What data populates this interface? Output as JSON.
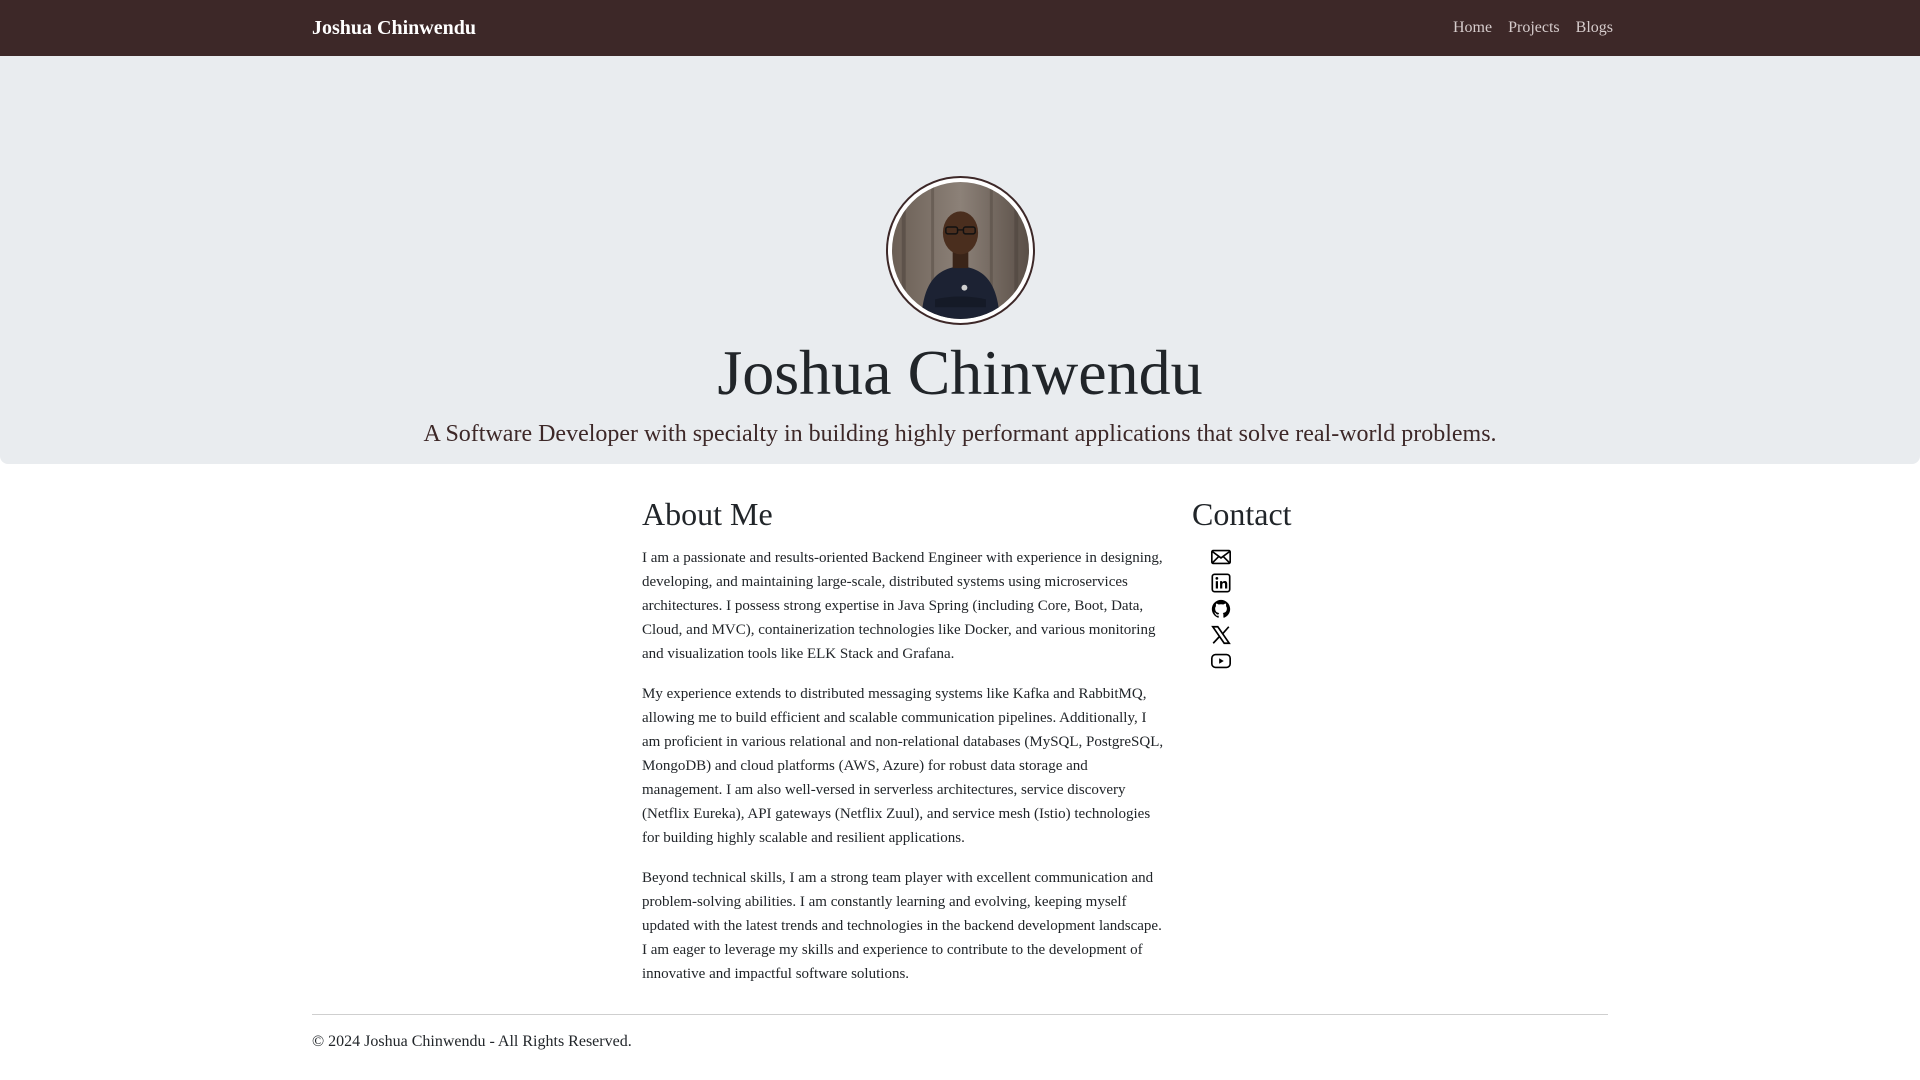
{
  "navbar": {
    "brand": "Joshua Chinwendu",
    "links": [
      "Home",
      "Projects",
      "Blogs"
    ]
  },
  "hero": {
    "title": "Joshua Chinwendu",
    "lead": "A Software Developer with specialty in building highly performant applications that solve real-world problems.",
    "avatar_icon": "profile-photo"
  },
  "about": {
    "title": "About Me",
    "paragraphs": [
      "I am a passionate and results-oriented Backend Engineer with experience in designing, developing, and maintaining large-scale, distributed systems using microservices architectures. I possess strong expertise in Java Spring (including Core, Boot, Data, Cloud, and MVC), containerization technologies like Docker, and various monitoring and visualization tools like ELK Stack and Grafana.",
      "My experience extends to distributed messaging systems like Kafka and RabbitMQ, allowing me to build efficient and scalable communication pipelines. Additionally, I am proficient in various relational and non-relational databases (MySQL, PostgreSQL, MongoDB) and cloud platforms (AWS, Azure) for robust data storage and management. I am also well-versed in serverless architectures, service discovery (Netflix Eureka), API gateways (Netflix Zuul), and service mesh (Istio) technologies for building highly scalable and resilient applications.",
      "Beyond technical skills, I am a strong team player with excellent communication and problem-solving abilities. I am constantly learning and evolving, keeping myself updated with the latest trends and technologies in the backend development landscape. I am eager to leverage my skills and experience to contribute to the development of innovative and impactful software solutions."
    ]
  },
  "contact": {
    "title": "Contact",
    "icons": [
      "envelope-icon",
      "linkedin-icon",
      "github-icon",
      "x-twitter-icon",
      "youtube-icon"
    ]
  },
  "footer": {
    "text": "© 2024 Joshua Chinwendu - All Rights Reserved."
  },
  "colors": {
    "navbar": "#3d2828",
    "hero_bg": "#e9ecef",
    "text": "#212529"
  }
}
